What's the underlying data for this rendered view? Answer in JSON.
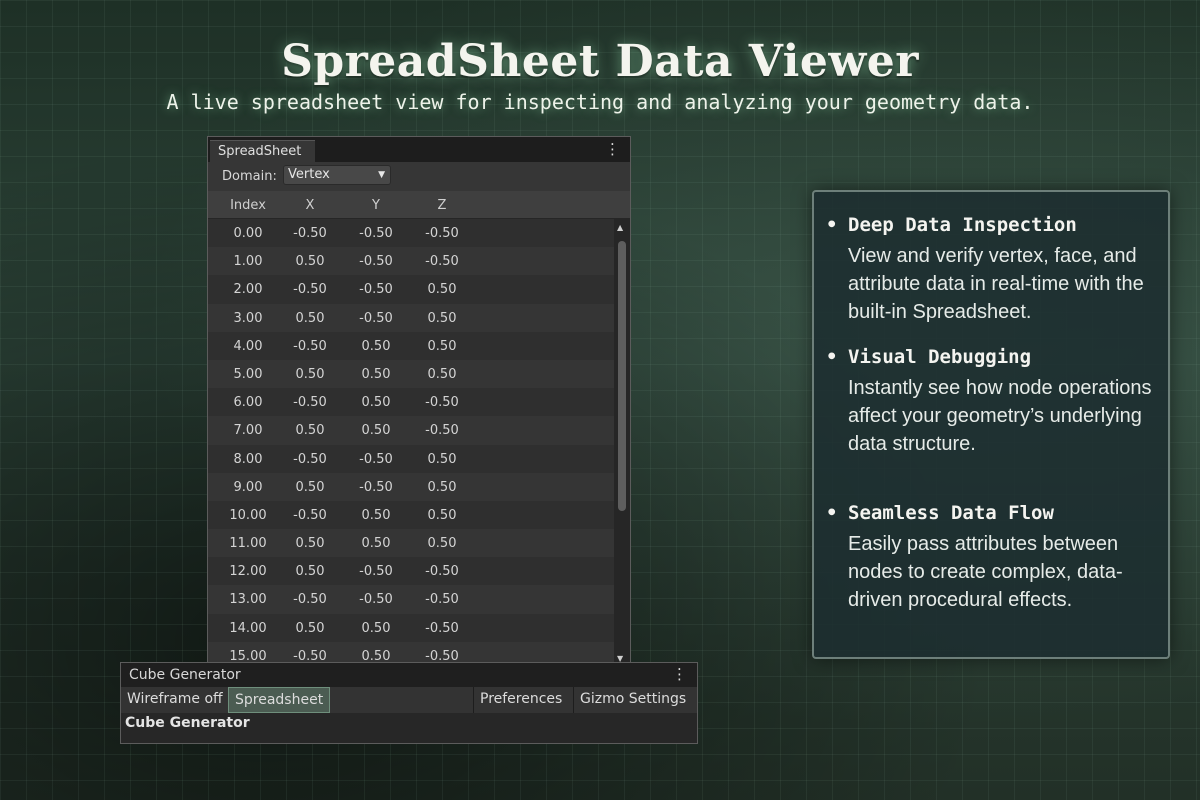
{
  "header": {
    "title": "SpreadSheet Data Viewer",
    "subtitle": "A live spreadsheet view for inspecting and analyzing your geometry data."
  },
  "spreadsheet": {
    "tab_label": "SpreadSheet",
    "domain_label": "Domain:",
    "domain_value": "Vertex",
    "columns": [
      "Index",
      "X",
      "Y",
      "Z"
    ],
    "rows": [
      [
        "0.00",
        "-0.50",
        "-0.50",
        "-0.50"
      ],
      [
        "1.00",
        "0.50",
        "-0.50",
        "-0.50"
      ],
      [
        "2.00",
        "-0.50",
        "-0.50",
        "0.50"
      ],
      [
        "3.00",
        "0.50",
        "-0.50",
        "0.50"
      ],
      [
        "4.00",
        "-0.50",
        "0.50",
        "0.50"
      ],
      [
        "5.00",
        "0.50",
        "0.50",
        "0.50"
      ],
      [
        "6.00",
        "-0.50",
        "0.50",
        "-0.50"
      ],
      [
        "7.00",
        "0.50",
        "0.50",
        "-0.50"
      ],
      [
        "8.00",
        "-0.50",
        "-0.50",
        "0.50"
      ],
      [
        "9.00",
        "0.50",
        "-0.50",
        "0.50"
      ],
      [
        "10.00",
        "-0.50",
        "0.50",
        "0.50"
      ],
      [
        "11.00",
        "0.50",
        "0.50",
        "0.50"
      ],
      [
        "12.00",
        "0.50",
        "-0.50",
        "-0.50"
      ],
      [
        "13.00",
        "-0.50",
        "-0.50",
        "-0.50"
      ],
      [
        "14.00",
        "0.50",
        "0.50",
        "-0.50"
      ],
      [
        "15.00",
        "-0.50",
        "0.50",
        "-0.50"
      ]
    ]
  },
  "cube_panel": {
    "title": "Cube Generator",
    "toolbar": {
      "wireframe": "Wireframe off",
      "spreadsheet": "Spreadsheet",
      "preferences": "Preferences",
      "gizmo": "Gizmo Settings"
    },
    "footer_label": "Cube Generator"
  },
  "features": [
    {
      "title": "Deep Data Inspection",
      "description": "View and verify vertex, face, and attribute data in real-time with the built-in Spreadsheet."
    },
    {
      "title": "Visual Debugging",
      "description": "Instantly see how node operations affect your geometry’s underlying data structure."
    },
    {
      "title": "Seamless Data Flow",
      "description": "Easily pass attributes between nodes to create complex, data-driven procedural effects."
    }
  ]
}
